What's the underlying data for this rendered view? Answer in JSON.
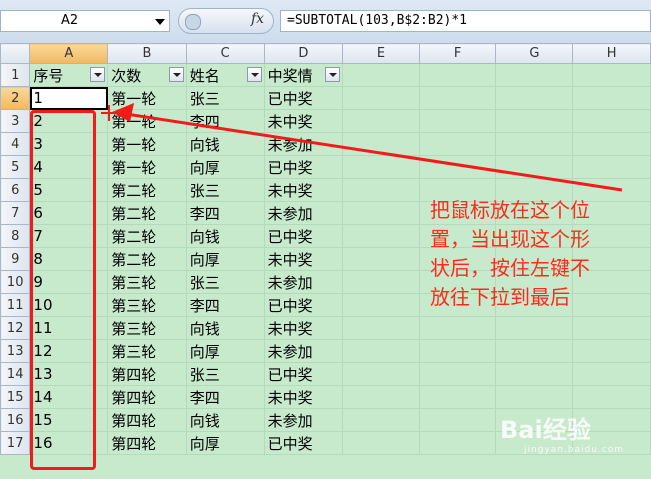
{
  "name_box": "A2",
  "fx_label": "fx",
  "formula": "=SUBTOTAL(103,B$2:B2)*1",
  "columns": [
    "A",
    "B",
    "C",
    "D",
    "E",
    "F",
    "G",
    "H"
  ],
  "header_row": [
    "序号",
    "次数",
    "姓名",
    "中奖情"
  ],
  "rows": [
    [
      "1",
      "第一轮",
      "张三",
      "已中奖"
    ],
    [
      "2",
      "第一轮",
      "李四",
      "未中奖"
    ],
    [
      "3",
      "第一轮",
      "向钱",
      "未参加"
    ],
    [
      "4",
      "第一轮",
      "向厚",
      "已中奖"
    ],
    [
      "5",
      "第二轮",
      "张三",
      "未中奖"
    ],
    [
      "6",
      "第二轮",
      "李四",
      "未参加"
    ],
    [
      "7",
      "第二轮",
      "向钱",
      "已中奖"
    ],
    [
      "8",
      "第二轮",
      "向厚",
      "未中奖"
    ],
    [
      "9",
      "第三轮",
      "张三",
      "未参加"
    ],
    [
      "10",
      "第三轮",
      "李四",
      "已中奖"
    ],
    [
      "11",
      "第三轮",
      "向钱",
      "未中奖"
    ],
    [
      "12",
      "第三轮",
      "向厚",
      "未参加"
    ],
    [
      "13",
      "第四轮",
      "张三",
      "已中奖"
    ],
    [
      "14",
      "第四轮",
      "李四",
      "未中奖"
    ],
    [
      "15",
      "第四轮",
      "向钱",
      "未参加"
    ],
    [
      "16",
      "第四轮",
      "向厚",
      "已中奖"
    ]
  ],
  "annotation_lines": [
    "把鼠标放在这个位",
    "置，当出现这个形",
    "状后，按住左键不",
    "放往下拉到最后"
  ],
  "watermark": "Bai经验",
  "watermark_sub": "jingyan.baidu.com",
  "colors": {
    "annotation": "#f31a1a",
    "sheet_bg": "#c7e9cc"
  }
}
